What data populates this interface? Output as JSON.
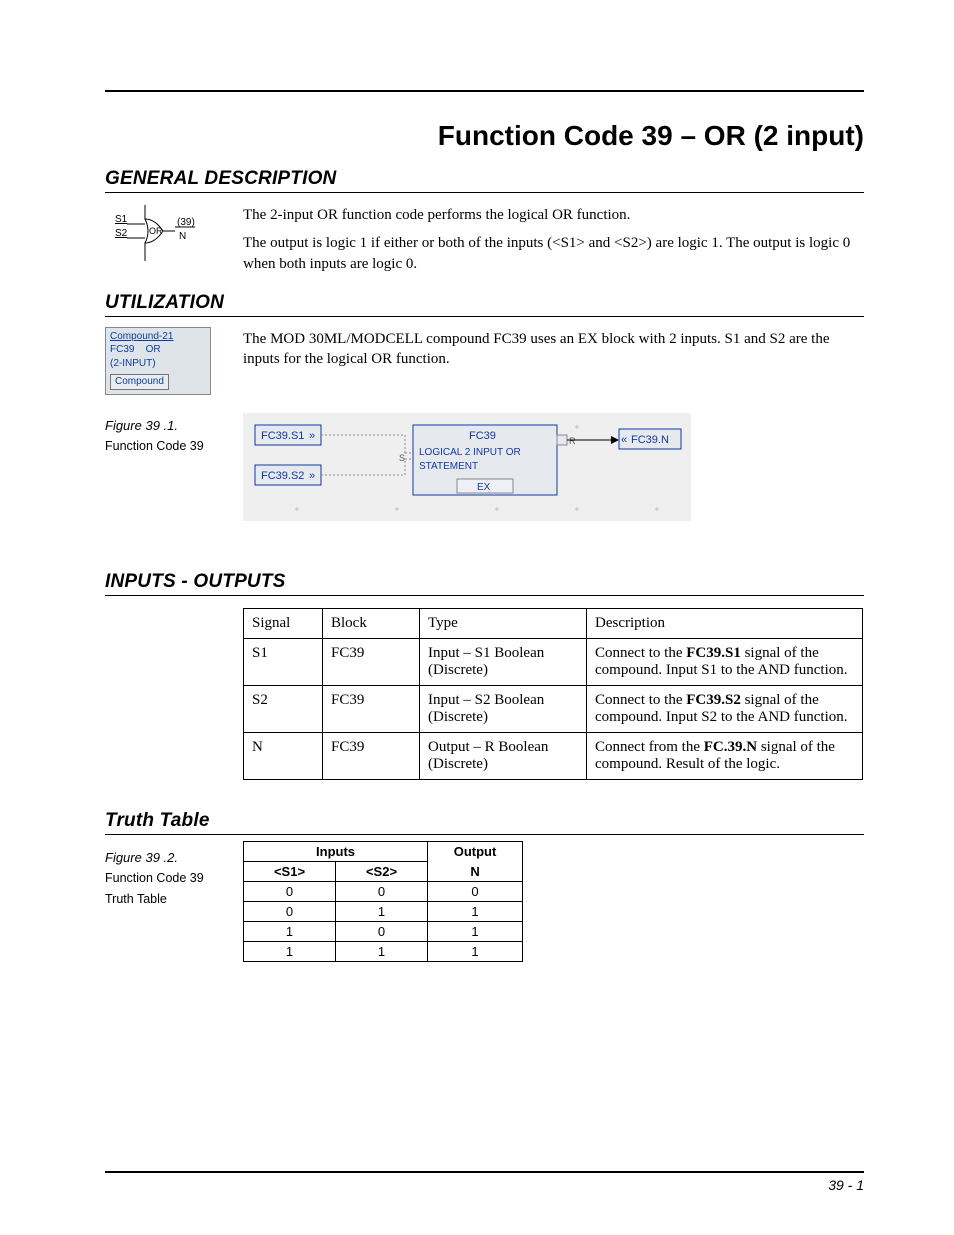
{
  "page": {
    "title": "Function Code 39 – OR (2 input)",
    "footer": "39 - 1"
  },
  "sections": {
    "general": {
      "heading": "GENERAL DESCRIPTION",
      "p1": "The 2-input OR function code performs the logical OR function.",
      "p2": "The output is logic 1 if either or both of the inputs (<S1> and <S2>) are logic 1. The output is logic 0 when both inputs are logic 0.",
      "gate": {
        "s1": "S1",
        "s2": "S2",
        "label": "OR",
        "num": "(39)",
        "out": "N"
      }
    },
    "utilization": {
      "heading": "UTILIZATION",
      "p1": "The MOD 30ML/MODCELL compound FC39 uses an EX block with 2 inputs. S1 and S2 are the inputs for the logical OR function.",
      "box": {
        "title": "Compound-21",
        "line1": "FC39    OR",
        "line2": "(2-INPUT)",
        "button": "Compound"
      },
      "fig": {
        "num": "Figure 39 .1.",
        "caption": "Function Code 39"
      },
      "diagram": {
        "s1": "FC39.S1",
        "s2": "FC39.S2",
        "block_top": "FC39",
        "block_mid": "LOGICAL 2 INPUT OR",
        "block_sub": "STATEMENT",
        "block_type": "EX",
        "r": "R",
        "out": "FC39.N"
      }
    },
    "io": {
      "heading": "INPUTS - OUTPUTS",
      "cols": {
        "signal": "Signal",
        "block": "Block",
        "type": "Type",
        "desc": "Description"
      },
      "rows": [
        {
          "signal": "S1",
          "block": "FC39",
          "type": "Input – S1 Boolean (Discrete)",
          "desc_pre": "Connect to the ",
          "desc_bold": "FC39.S1",
          "desc_post": " signal of the compound. Input S1 to the AND function."
        },
        {
          "signal": "S2",
          "block": "FC39",
          "type": "Input – S2 Boolean (Discrete)",
          "desc_pre": "Connect to the ",
          "desc_bold": "FC39.S2",
          "desc_post": " signal of the compound. Input S2 to the AND function."
        },
        {
          "signal": "N",
          "block": "FC39",
          "type": "Output – R Boolean (Discrete)",
          "desc_pre": "Connect from the ",
          "desc_bold": "FC.39.N",
          "desc_post": " signal of the compound. Result of the logic."
        }
      ]
    },
    "truth": {
      "heading": "Truth Table",
      "fig": {
        "num": "Figure 39 .2.",
        "caption1": "Function Code 39",
        "caption2": "Truth Table"
      },
      "hdr_inputs": "Inputs",
      "hdr_output": "Output",
      "col_s1": "<S1>",
      "col_s2": "<S2>",
      "col_n": "N",
      "rows": [
        {
          "s1": "0",
          "s2": "0",
          "n": "0"
        },
        {
          "s1": "0",
          "s2": "1",
          "n": "1"
        },
        {
          "s1": "1",
          "s2": "0",
          "n": "1"
        },
        {
          "s1": "1",
          "s2": "1",
          "n": "1"
        }
      ]
    }
  }
}
